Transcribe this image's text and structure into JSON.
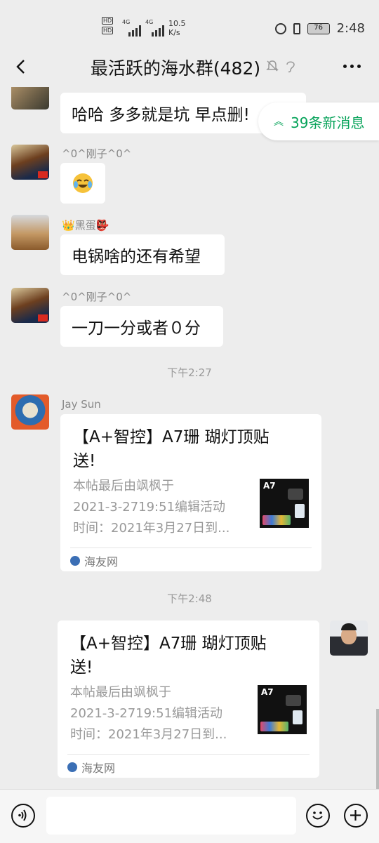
{
  "status_bar": {
    "net1": "4G",
    "net2": "4G",
    "speed_value": "10.5",
    "speed_unit": "K/s",
    "battery": "76",
    "time": "2:48"
  },
  "header": {
    "title": "最活跃的海水群(482)"
  },
  "new_messages_pill": "39条新消息",
  "messages": [
    {
      "sender": "",
      "text": "哈哈 多多就是坑 早点删!"
    },
    {
      "sender": "^0^刚子^0^",
      "text": "😭"
    },
    {
      "sender": "黑蛋",
      "sender_prefix": "👑",
      "sender_suffix": "👺",
      "text": "电锅啥的还有希望"
    },
    {
      "sender": "^0^刚子^0^",
      "text": "一刀一分或者０分"
    }
  ],
  "timestamps": [
    "下午2:27",
    "下午2:48"
  ],
  "cards": [
    {
      "sender": "Jay Sun",
      "title_line1": "【A+智控】A7珊 瑚灯顶贴",
      "title_line2": "送!",
      "desc": [
        "本帖最后由飒枫于",
        "2021-3-2719:51编辑活动",
        "时间：2021年3月27日到..."
      ],
      "source": "海友网",
      "thumb_label": "A7"
    },
    {
      "sender": "",
      "title_line1": "【A+智控】A7珊 瑚灯顶贴",
      "title_line2": "送!",
      "desc": [
        "本帖最后由飒枫于",
        "2021-3-2719:51编辑活动",
        "时间：2021年3月27日到..."
      ],
      "source": "海友网",
      "thumb_label": "A7"
    }
  ],
  "input": {
    "value": ""
  },
  "colors": {
    "accent_green": "#07a35a",
    "background": "#ededed"
  }
}
